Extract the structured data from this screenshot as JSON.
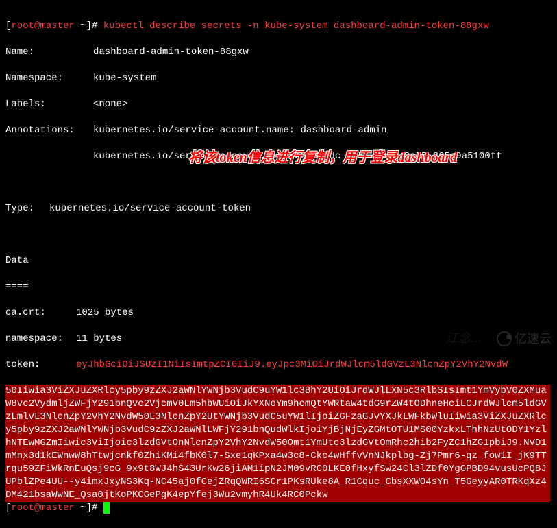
{
  "prompt": {
    "open": "[",
    "user_host": "root@master",
    "path": " ~",
    "close": "]# ",
    "command": "kubectl describe secrets -n kube-system dashboard-admin-token-88gxw"
  },
  "secret": {
    "name_key": "Name:",
    "name_val": "dashboard-admin-token-88gxw",
    "namespace_key": "Namespace:",
    "namespace_val": "kube-system",
    "labels_key": "Labels:",
    "labels_val": "<none>",
    "annotations_key": "Annotations:",
    "annotations_val1": "kubernetes.io/service-account.name: dashboard-admin",
    "annotations_val2": "kubernetes.io/service-account.uid: b0c612dc-9551-4c91-8a75-865c9a5100ff",
    "type_key": "Type:",
    "type_val": "kubernetes.io/service-account-token",
    "data_header": "Data",
    "data_divider": "====",
    "ca_crt_key": "ca.crt:",
    "ca_crt_val": "1025 bytes",
    "namespace2_key": "namespace:",
    "namespace2_val": "11 bytes",
    "token_key": "token:",
    "token_first": "eyJhbGciOiJSUzI1NiIsImtpZCI6IiJ9.eyJpc3MiOiJrdWJlcm5ldGVzL3NlcnZpY2VhY2NvdW",
    "token_rest": "50Iiwia3ViZXJuZXRlcy5pby9zZXJ2aWNlYWNjb3VudC9uYW1lc3BhY2UiOiJrdWJlLXN5c3RlbSIsImt1YmVybV0ZXMuaW8vc2VydmljZWFjY291bnQvc2VjcmV0Lm5hbWUiOiJkYXNoYm9hcmQtYWRtaW4tdG9rZW4tODhneHciLCJrdWJlcm5ldGVzLmlvL3NlcnZpY2VhY2NvdW50L3NlcnZpY2UtYWNjb3VudC5uYW1lIjoiZGFzaGJvYXJkLWFkbWluIiwia3ViZXJuZXRlcy5pby9zZXJ2aWNlYWNjb3VudC9zZXJ2aWNlLWFjY291bnQudWlkIjoiYjBjNjEyZGMtOTU1MS00YzkxLThhNzUtODY1YzlhNTEwMGZmIiwic3ViIjoic3lzdGVtOnNlcnZpY2VhY2NvdW50Omt1YmUtc3lzdGVtOmRhc2hib2FyZC1hZG1pbiJ9.NVD1mMnx3d1kEWnwW8hTtwjcnkf0ZhiKMi4fbK0l7-Sxe1qKPxa4w3c8-Ckc4wHffvVnNJkplbg-Zj7Pmr6-qz_fow1I_jK9TTrqu59ZFiWkRnEuQsj9cG_9x9t8WJ4hS43UrKw26jiAM1ipN2JM09vRC0LKE0fHxyfSw24Cl3lZDf0YgGPBD94vusUcPQBJUPblZPe4UU--y4imxJxyNS3Kq-NC45aj0fCejZRqQWRI6SCr1PKsRUke8A_R1Cquc_CbsXXWO4sYn_T5GeyyAR0TRKqXz4DM421bsaWwNE_Qsa0jtKoPKCGePgK4epYfej3Wu2vmyhR4Uk4RC0Pckw"
  },
  "annotation_text": "将该token信息进行复制，用于登录dashboard",
  "watermark1": "江念…",
  "watermark2": "亿速云"
}
